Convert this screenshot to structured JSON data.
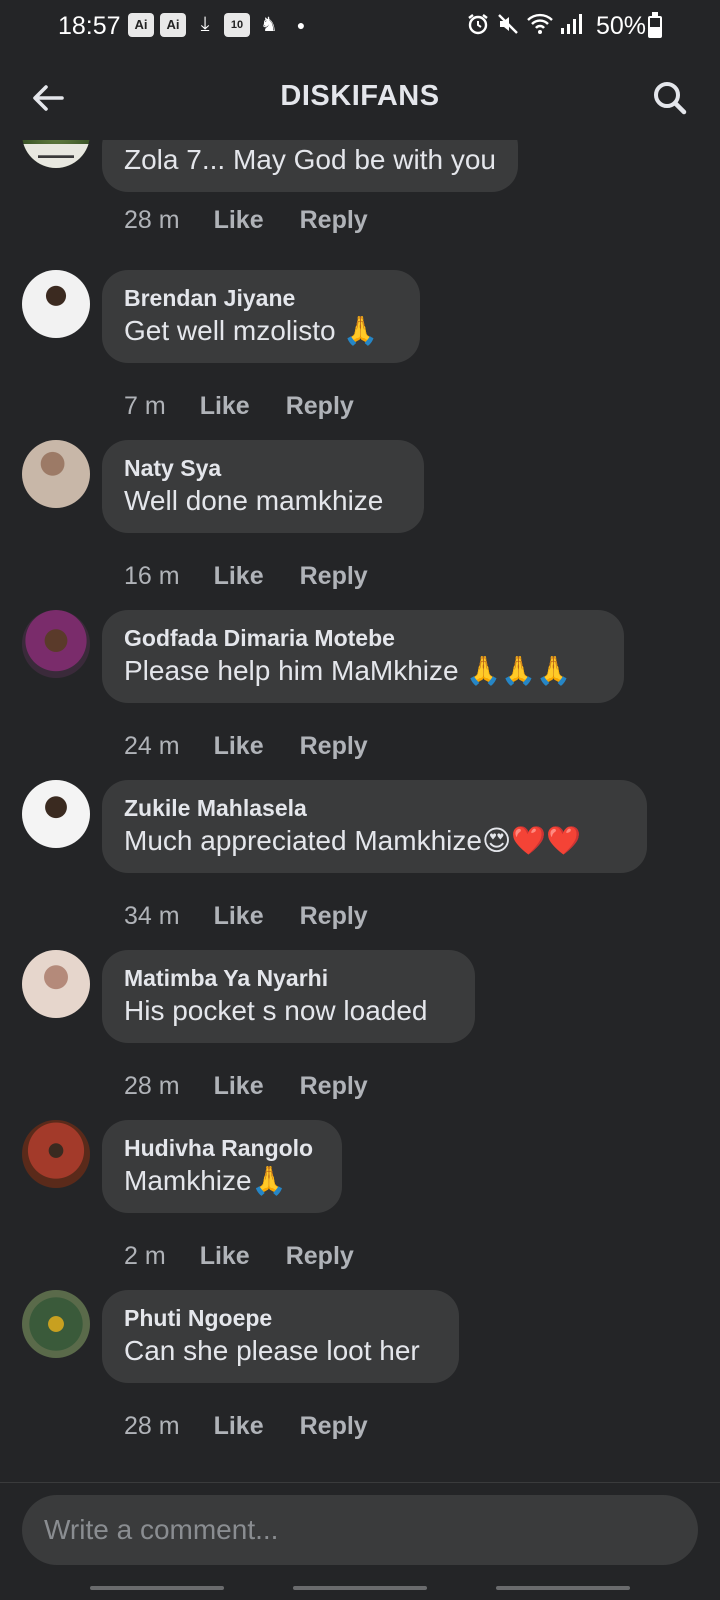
{
  "status_bar": {
    "time": "18:57",
    "badge_1": "Ai",
    "badge_2": "Ai",
    "badge_3": "10",
    "battery": "50%",
    "battery_level": 0.5
  },
  "header": {
    "title": "DISKIFANS"
  },
  "colors": {
    "background": "#242527",
    "bubble": "#3a3b3c",
    "primary_text": "#e4e6eb",
    "secondary_text": "#b0b3b8"
  },
  "top_comment": {
    "text": "Zola 7... May God be with you",
    "time": "28 m",
    "like": "Like",
    "reply": "Reply"
  },
  "comments": [
    {
      "author": "Brendan Jiyane",
      "text": "Get well mzolisto 🙏",
      "time": "7 m",
      "like": "Like",
      "reply": "Reply"
    },
    {
      "author": "Naty Sya",
      "text": "Well done mamkhize",
      "time": "16 m",
      "like": "Like",
      "reply": "Reply"
    },
    {
      "author": "Godfada Dimaria Motebe",
      "text": "Please help him MaMkhize 🙏🙏🙏",
      "time": "24 m",
      "like": "Like",
      "reply": "Reply"
    },
    {
      "author": "Zukile Mahlasela",
      "text": "Much appreciated Mamkhize😍❤️❤️",
      "time": "34 m",
      "like": "Like",
      "reply": "Reply"
    },
    {
      "author": "Matimba Ya Nyarhi",
      "text": "His pocket s now loaded",
      "time": "28 m",
      "like": "Like",
      "reply": "Reply"
    },
    {
      "author": "Hudivha Rangolo",
      "text": "Mamkhize🙏",
      "time": "2 m",
      "like": "Like",
      "reply": "Reply"
    },
    {
      "author": "Phuti Ngoepe",
      "text": "Can she please loot her",
      "time": "28 m",
      "like": "Like",
      "reply": "Reply"
    }
  ],
  "composer": {
    "placeholder": "Write a comment..."
  }
}
